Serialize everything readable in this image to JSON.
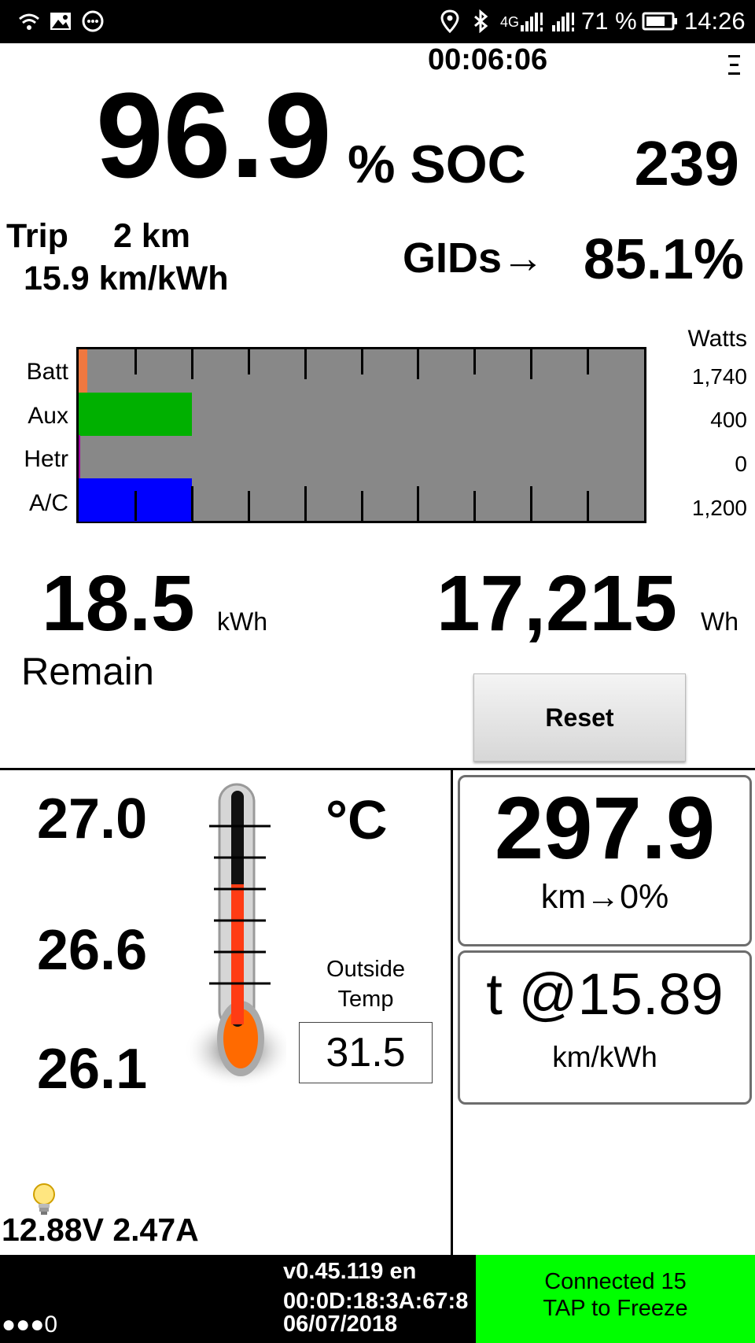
{
  "status_bar": {
    "network": "4G",
    "battery_percent": "71 %",
    "time": "14:26",
    "icons": [
      "wifi-icon",
      "image-icon",
      "chat-icon",
      "location-icon",
      "bluetooth-icon",
      "signal-icon",
      "battery-icon"
    ]
  },
  "header": {
    "elapsed": "00:06:06",
    "menu_icon": "menu-icon"
  },
  "soc": {
    "value": "96.9",
    "unit": "% SOC",
    "gids": "239",
    "gids_label": "GIDs→",
    "gids_percent": "85.1%"
  },
  "trip": {
    "label": "Trip",
    "distance": "2 km",
    "efficiency": "15.9 km/kWh"
  },
  "power_gauge": {
    "header": "Watts",
    "max_watts": 2000,
    "rows": [
      {
        "label": "Batt",
        "watts": "1,740",
        "level": 0.015,
        "color": "#f07840"
      },
      {
        "label": "Aux",
        "watts": "400",
        "level": 0.2,
        "color": "#00b000"
      },
      {
        "label": "Hetr",
        "watts": "0",
        "level": 0.0,
        "color": "#a000a0"
      },
      {
        "label": "A/C",
        "watts": "1,200",
        "level": 0.2,
        "color": "#0000ff"
      }
    ]
  },
  "energy": {
    "remain_value": "18.5",
    "remain_unit": "kWh",
    "remain_label": "Remain",
    "used_value": "17,215",
    "used_unit": "Wh",
    "reset_label": "Reset"
  },
  "temps": {
    "battery_temps": [
      "27.0",
      "26.6",
      "26.1"
    ],
    "unit": "°C",
    "thermometer_fill": 0.6,
    "outside_label_1": "Outside",
    "outside_label_2": "Temp",
    "outside_value": "31.5"
  },
  "range": {
    "distance": "297.9",
    "distance_label": "km→0%",
    "efficiency": "t @15.89",
    "efficiency_unit": "km/kWh"
  },
  "twelve_volt": {
    "reading": "12.88V 2.47A",
    "icon": "lightbulb-icon"
  },
  "footer": {
    "dots": "●●●0",
    "version": "v0.45.119 en",
    "device_id": "00:0D:18:3A:67:8",
    "date": "06/07/2018",
    "connected": "Connected 15",
    "tap_hint": "TAP to Freeze"
  }
}
